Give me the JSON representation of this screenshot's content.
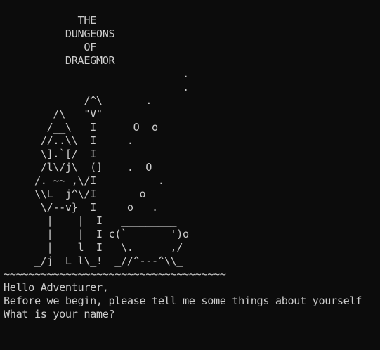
{
  "terminal": {
    "ascii_art": "            THE\n          DUNGEONS\n             OF\n          DRAEGMOR\n                             .\n                             .\n             /^\\       .\n        /\\   \"V\"\n       /__\\   I      O  o\n      //..\\\\  I     .\n      \\].`[/  I\n      /l\\/j\\  (]    .  O\n     /. ~~ ,\\/I          .\n     \\\\L__j^\\/I       o\n      \\/--v}  I     o   .\n       |    |  I   _________\n       |    |  I c(`       ')o\n       |    l  I   \\.      ,/\n     _/j  L l\\_!  _//^---^\\\\_\n~~~~~~~~~~~~~~~~~~~~~~~~~~~~~~~~~~~~",
    "lines": [
      "Hello Adventurer,",
      "Before we begin, please tell me some things about yourself",
      "What is your name?"
    ],
    "input_value": ""
  }
}
